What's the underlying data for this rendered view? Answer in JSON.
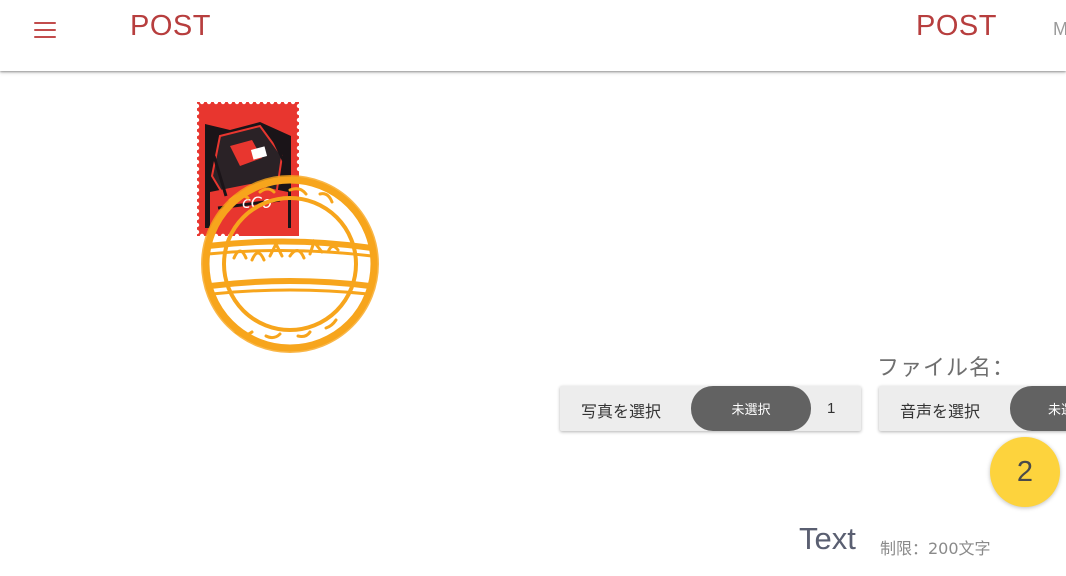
{
  "header": {
    "menu_icon": "hamburger-menu-icon",
    "brand": "POST",
    "nav_post": "POST",
    "nav_more": "M",
    "accent_color": "#b73e3e"
  },
  "stamp": {
    "stamp_icon": "postage-stamp-image",
    "postmark_icon": "postmark-image",
    "postmark_color": "#f7a51c"
  },
  "file_section": {
    "label": "ファイル名：",
    "photo": {
      "select_label": "写真を選択",
      "status": "未選択",
      "count": "1"
    },
    "audio": {
      "select_label": "音声を選択",
      "status": "未選択"
    }
  },
  "step_badge": {
    "value": "2",
    "color": "#fdd33d"
  },
  "text_section": {
    "title": "Text",
    "limit": "制限：200文字"
  }
}
